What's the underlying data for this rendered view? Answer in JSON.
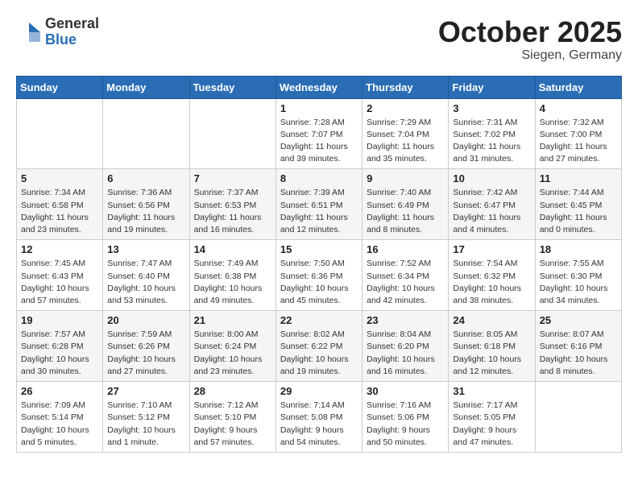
{
  "header": {
    "logo_general": "General",
    "logo_blue": "Blue",
    "month": "October 2025",
    "location": "Siegen, Germany"
  },
  "days_of_week": [
    "Sunday",
    "Monday",
    "Tuesday",
    "Wednesday",
    "Thursday",
    "Friday",
    "Saturday"
  ],
  "weeks": [
    [
      {
        "day": "",
        "sunrise": "",
        "sunset": "",
        "daylight": ""
      },
      {
        "day": "",
        "sunrise": "",
        "sunset": "",
        "daylight": ""
      },
      {
        "day": "",
        "sunrise": "",
        "sunset": "",
        "daylight": ""
      },
      {
        "day": "1",
        "sunrise": "Sunrise: 7:28 AM",
        "sunset": "Sunset: 7:07 PM",
        "daylight": "Daylight: 11 hours and 39 minutes."
      },
      {
        "day": "2",
        "sunrise": "Sunrise: 7:29 AM",
        "sunset": "Sunset: 7:04 PM",
        "daylight": "Daylight: 11 hours and 35 minutes."
      },
      {
        "day": "3",
        "sunrise": "Sunrise: 7:31 AM",
        "sunset": "Sunset: 7:02 PM",
        "daylight": "Daylight: 11 hours and 31 minutes."
      },
      {
        "day": "4",
        "sunrise": "Sunrise: 7:32 AM",
        "sunset": "Sunset: 7:00 PM",
        "daylight": "Daylight: 11 hours and 27 minutes."
      }
    ],
    [
      {
        "day": "5",
        "sunrise": "Sunrise: 7:34 AM",
        "sunset": "Sunset: 6:58 PM",
        "daylight": "Daylight: 11 hours and 23 minutes."
      },
      {
        "day": "6",
        "sunrise": "Sunrise: 7:36 AM",
        "sunset": "Sunset: 6:56 PM",
        "daylight": "Daylight: 11 hours and 19 minutes."
      },
      {
        "day": "7",
        "sunrise": "Sunrise: 7:37 AM",
        "sunset": "Sunset: 6:53 PM",
        "daylight": "Daylight: 11 hours and 16 minutes."
      },
      {
        "day": "8",
        "sunrise": "Sunrise: 7:39 AM",
        "sunset": "Sunset: 6:51 PM",
        "daylight": "Daylight: 11 hours and 12 minutes."
      },
      {
        "day": "9",
        "sunrise": "Sunrise: 7:40 AM",
        "sunset": "Sunset: 6:49 PM",
        "daylight": "Daylight: 11 hours and 8 minutes."
      },
      {
        "day": "10",
        "sunrise": "Sunrise: 7:42 AM",
        "sunset": "Sunset: 6:47 PM",
        "daylight": "Daylight: 11 hours and 4 minutes."
      },
      {
        "day": "11",
        "sunrise": "Sunrise: 7:44 AM",
        "sunset": "Sunset: 6:45 PM",
        "daylight": "Daylight: 11 hours and 0 minutes."
      }
    ],
    [
      {
        "day": "12",
        "sunrise": "Sunrise: 7:45 AM",
        "sunset": "Sunset: 6:43 PM",
        "daylight": "Daylight: 10 hours and 57 minutes."
      },
      {
        "day": "13",
        "sunrise": "Sunrise: 7:47 AM",
        "sunset": "Sunset: 6:40 PM",
        "daylight": "Daylight: 10 hours and 53 minutes."
      },
      {
        "day": "14",
        "sunrise": "Sunrise: 7:49 AM",
        "sunset": "Sunset: 6:38 PM",
        "daylight": "Daylight: 10 hours and 49 minutes."
      },
      {
        "day": "15",
        "sunrise": "Sunrise: 7:50 AM",
        "sunset": "Sunset: 6:36 PM",
        "daylight": "Daylight: 10 hours and 45 minutes."
      },
      {
        "day": "16",
        "sunrise": "Sunrise: 7:52 AM",
        "sunset": "Sunset: 6:34 PM",
        "daylight": "Daylight: 10 hours and 42 minutes."
      },
      {
        "day": "17",
        "sunrise": "Sunrise: 7:54 AM",
        "sunset": "Sunset: 6:32 PM",
        "daylight": "Daylight: 10 hours and 38 minutes."
      },
      {
        "day": "18",
        "sunrise": "Sunrise: 7:55 AM",
        "sunset": "Sunset: 6:30 PM",
        "daylight": "Daylight: 10 hours and 34 minutes."
      }
    ],
    [
      {
        "day": "19",
        "sunrise": "Sunrise: 7:57 AM",
        "sunset": "Sunset: 6:28 PM",
        "daylight": "Daylight: 10 hours and 30 minutes."
      },
      {
        "day": "20",
        "sunrise": "Sunrise: 7:59 AM",
        "sunset": "Sunset: 6:26 PM",
        "daylight": "Daylight: 10 hours and 27 minutes."
      },
      {
        "day": "21",
        "sunrise": "Sunrise: 8:00 AM",
        "sunset": "Sunset: 6:24 PM",
        "daylight": "Daylight: 10 hours and 23 minutes."
      },
      {
        "day": "22",
        "sunrise": "Sunrise: 8:02 AM",
        "sunset": "Sunset: 6:22 PM",
        "daylight": "Daylight: 10 hours and 19 minutes."
      },
      {
        "day": "23",
        "sunrise": "Sunrise: 8:04 AM",
        "sunset": "Sunset: 6:20 PM",
        "daylight": "Daylight: 10 hours and 16 minutes."
      },
      {
        "day": "24",
        "sunrise": "Sunrise: 8:05 AM",
        "sunset": "Sunset: 6:18 PM",
        "daylight": "Daylight: 10 hours and 12 minutes."
      },
      {
        "day": "25",
        "sunrise": "Sunrise: 8:07 AM",
        "sunset": "Sunset: 6:16 PM",
        "daylight": "Daylight: 10 hours and 8 minutes."
      }
    ],
    [
      {
        "day": "26",
        "sunrise": "Sunrise: 7:09 AM",
        "sunset": "Sunset: 5:14 PM",
        "daylight": "Daylight: 10 hours and 5 minutes."
      },
      {
        "day": "27",
        "sunrise": "Sunrise: 7:10 AM",
        "sunset": "Sunset: 5:12 PM",
        "daylight": "Daylight: 10 hours and 1 minute."
      },
      {
        "day": "28",
        "sunrise": "Sunrise: 7:12 AM",
        "sunset": "Sunset: 5:10 PM",
        "daylight": "Daylight: 9 hours and 57 minutes."
      },
      {
        "day": "29",
        "sunrise": "Sunrise: 7:14 AM",
        "sunset": "Sunset: 5:08 PM",
        "daylight": "Daylight: 9 hours and 54 minutes."
      },
      {
        "day": "30",
        "sunrise": "Sunrise: 7:16 AM",
        "sunset": "Sunset: 5:06 PM",
        "daylight": "Daylight: 9 hours and 50 minutes."
      },
      {
        "day": "31",
        "sunrise": "Sunrise: 7:17 AM",
        "sunset": "Sunset: 5:05 PM",
        "daylight": "Daylight: 9 hours and 47 minutes."
      },
      {
        "day": "",
        "sunrise": "",
        "sunset": "",
        "daylight": ""
      }
    ]
  ]
}
